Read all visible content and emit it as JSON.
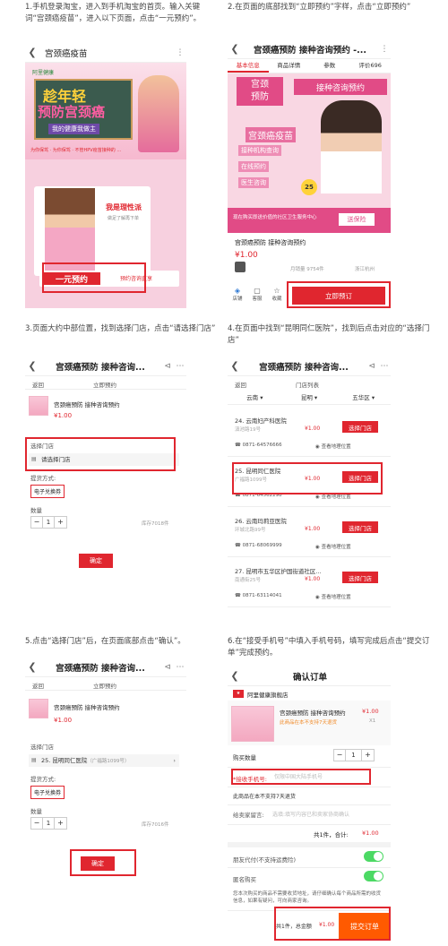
{
  "steps": [
    "1.手机登录淘宝，进入到手机淘宝的首页。输入关键词“宫颈癌疫苗”，进入以下页面，点击“一元预约”。",
    "2.在页面的底部找到“立即预约”字样，点击“立即预约”",
    "3.页面大约中部位置，找到选择门店，点击“请选择门店”",
    "4.在页面中找到“昆明同仁医院”，找到后点击对应的“选择门店”",
    "5.点击“选择门店”后，在页面底部点击“确认”。",
    "6.在“接受手机号”中填入手机号码，填写完成后点击“提交订单”完成预约。"
  ],
  "s1": {
    "title": "宫颈癌疫苗",
    "brand": "阿里健康",
    "headline1": "趁年轻",
    "headline2": "预防宫颈癌",
    "slogan": "我的健康我做主",
    "subline": "为你保驾 · 为你保驾 · 不管HPV疫苗接种的 …",
    "bubble": "我是理性派",
    "bubble_sub": "做足了解再下单",
    "cta": "一元预约",
    "cta_note": "预约咨询直享"
  },
  "s2": {
    "title": "宫颈癌预防 接种咨询预约 -...",
    "tabs": [
      "基本信息",
      "商品详情",
      "参数",
      "评价696"
    ],
    "banner_left1": "宫颈",
    "banner_left2": "预防",
    "banner_right": "接种咨询预约",
    "vaccine": "宫颈癌疫苗",
    "features": [
      "接种机构查询",
      "在线预约",
      "医生咨询"
    ],
    "age": "25",
    "promo": "现在购买即送价值的社区卫生服务中心",
    "promo_btn": "送保险",
    "name": "宫颈癌预防 接种咨询预约",
    "price": "¥1.00",
    "sold": "月销量 9754件",
    "ship": "浙江杭州",
    "bottom": [
      "店铺",
      "客服",
      "收藏"
    ],
    "buy": "立即预订"
  },
  "s3": {
    "title": "宫颈癌预防 接种咨询...",
    "back": "返回",
    "tab": "立即预约",
    "item": "宫颈癌预防 接种咨询预约",
    "price": "¥1.00",
    "store_label": "选择门店",
    "store_ph": "请选择门店",
    "pay_label": "提货方式:",
    "pay_value": "电子兑换券",
    "qty_label": "数量",
    "qty": "1",
    "stock": "库存7018件",
    "confirm": "确定"
  },
  "s4": {
    "title": "宫颈癌预防 接种咨询...",
    "back": "返回",
    "tab": "门店列表",
    "filters": [
      "云南",
      "昆明",
      "五华区"
    ],
    "stores": [
      {
        "name": "24. 云南妇产科医院",
        "addr": "滇池路19号",
        "price": "¥1.00",
        "phone": "0871-64576666"
      },
      {
        "name": "25. 昆明同仁医院",
        "addr": "广福路1099号",
        "price": "¥1.00",
        "phone": "0871-64562298"
      },
      {
        "name": "26. 云南玛莉亚医院",
        "addr": "环城北路99号",
        "price": "¥1.00",
        "phone": "0871-68069999"
      },
      {
        "name": "27. 昆明市五华区护国街道社区...",
        "addr": "南通街25号",
        "price": "¥1.00",
        "phone": "0871-63114041"
      }
    ],
    "sel": "选择门店",
    "map": "查看地理位置"
  },
  "s5": {
    "title": "宫颈癌预防 接种咨询...",
    "back": "返回",
    "tab": "立即预约",
    "item": "宫颈癌预防 接种咨询预约",
    "price": "¥1.00",
    "store_label": "选择门店",
    "store_value": "25. 昆明同仁医院",
    "store_addr": "（广福路1099号）",
    "pay_label": "提货方式:",
    "pay_value": "电子兑换券",
    "qty_label": "数量",
    "qty": "1",
    "stock": "库存7016件",
    "confirm": "确定"
  },
  "s6": {
    "title": "确认订单",
    "shop": "阿里健康旗舰店",
    "item": "宫颈癌预防 接种咨询预约",
    "item_note": "此商品在本不支持7天退货",
    "price": "¥1.00",
    "count": "X1",
    "qty_label": "购买数量",
    "qty": "1",
    "phone_label": "*接收手机号:",
    "phone_ph": "仅限中国大陆手机号",
    "no_return": "此商品在本不支持7天退货",
    "msg_label": "给卖家留言:",
    "msg_ph": "选填:填写内容已和卖家协商确认",
    "subtotal_label": "共1件，合计:",
    "subtotal": "¥1.00",
    "friend_pay": "朋友代付(不支持运费险)",
    "anon": "匿名购买",
    "notice": "您本次购买的商品不需要收货地址，请仔细确认每个商品所需的收货信息，如果有疑问，可向商家咨询。",
    "total_label": "共1件，总金额",
    "total": "¥1.00",
    "submit": "提交订单"
  }
}
